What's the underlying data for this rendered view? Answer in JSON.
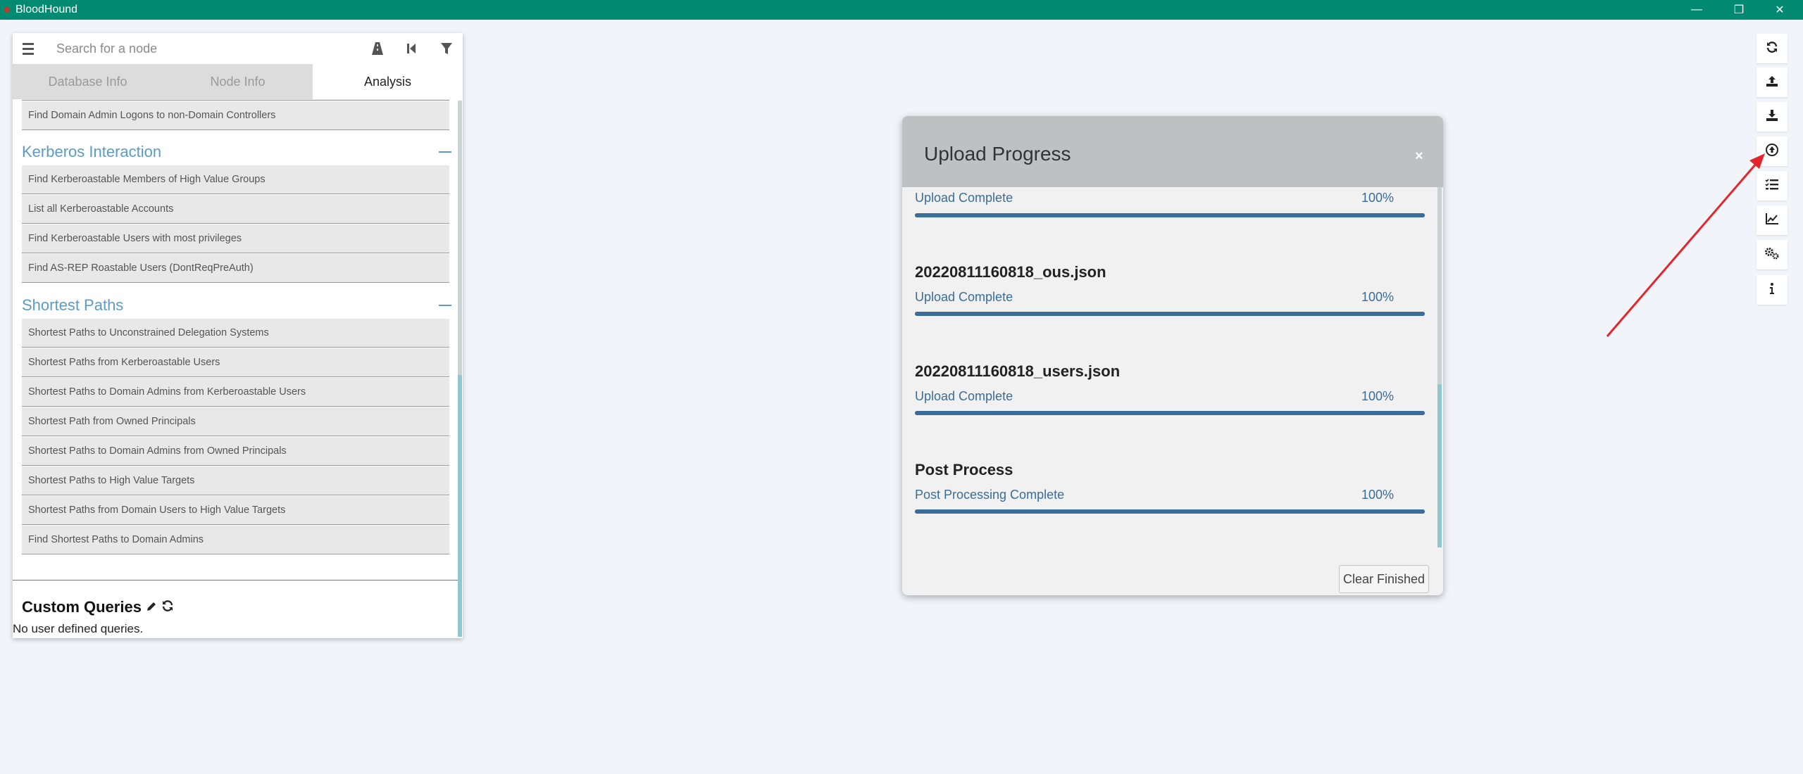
{
  "window": {
    "title": "BloodHound",
    "controls": {
      "minimize": "—",
      "restore": "❐",
      "close": "✕"
    }
  },
  "search": {
    "placeholder": "Search for a node"
  },
  "tabs": [
    {
      "label": "Database Info",
      "active": false
    },
    {
      "label": "Node Info",
      "active": false
    },
    {
      "label": "Analysis",
      "active": true
    }
  ],
  "analysis": {
    "prev_item": "Find Domain Admin Logons to non-Domain Controllers",
    "sections": [
      {
        "title": "Kerberos Interaction",
        "items": [
          "Find Kerberoastable Members of High Value Groups",
          "List all Kerberoastable Accounts",
          "Find Kerberoastable Users with most privileges",
          "Find AS-REP Roastable Users (DontReqPreAuth)"
        ]
      },
      {
        "title": "Shortest Paths",
        "items": [
          "Shortest Paths to Unconstrained Delegation Systems",
          "Shortest Paths from Kerberoastable Users",
          "Shortest Paths to Domain Admins from Kerberoastable Users",
          "Shortest Path from Owned Principals",
          "Shortest Paths to Domain Admins from Owned Principals",
          "Shortest Paths to High Value Targets",
          "Shortest Paths from Domain Users to High Value Targets",
          "Find Shortest Paths to Domain Admins"
        ]
      }
    ],
    "custom_queries": {
      "title": "Custom Queries",
      "empty_text": "No user defined queries."
    }
  },
  "upload_modal": {
    "title": "Upload Progress",
    "close": "×",
    "entries": [
      {
        "file": "",
        "status": "Upload Complete",
        "percent": "100%",
        "progress": 1.0
      },
      {
        "file": "20220811160818_ous.json",
        "status": "Upload Complete",
        "percent": "100%",
        "progress": 1.0
      },
      {
        "file": "20220811160818_users.json",
        "status": "Upload Complete",
        "percent": "100%",
        "progress": 1.0
      },
      {
        "file": "Post Process",
        "status": "Post Processing Complete",
        "percent": "100%",
        "progress": 1.0
      }
    ],
    "clear_button": "Clear Finished"
  },
  "right_toolbar": [
    "refresh-icon",
    "export-graph-icon",
    "import-graph-icon",
    "upload-data-icon",
    "queued-tasks-icon",
    "database-stats-icon",
    "settings-icon",
    "about-icon"
  ],
  "colors": {
    "titlebar": "#008a72",
    "section": "#5b9bc4",
    "progress": "#3a6d98",
    "annotation_arrow": "#e3262c"
  }
}
